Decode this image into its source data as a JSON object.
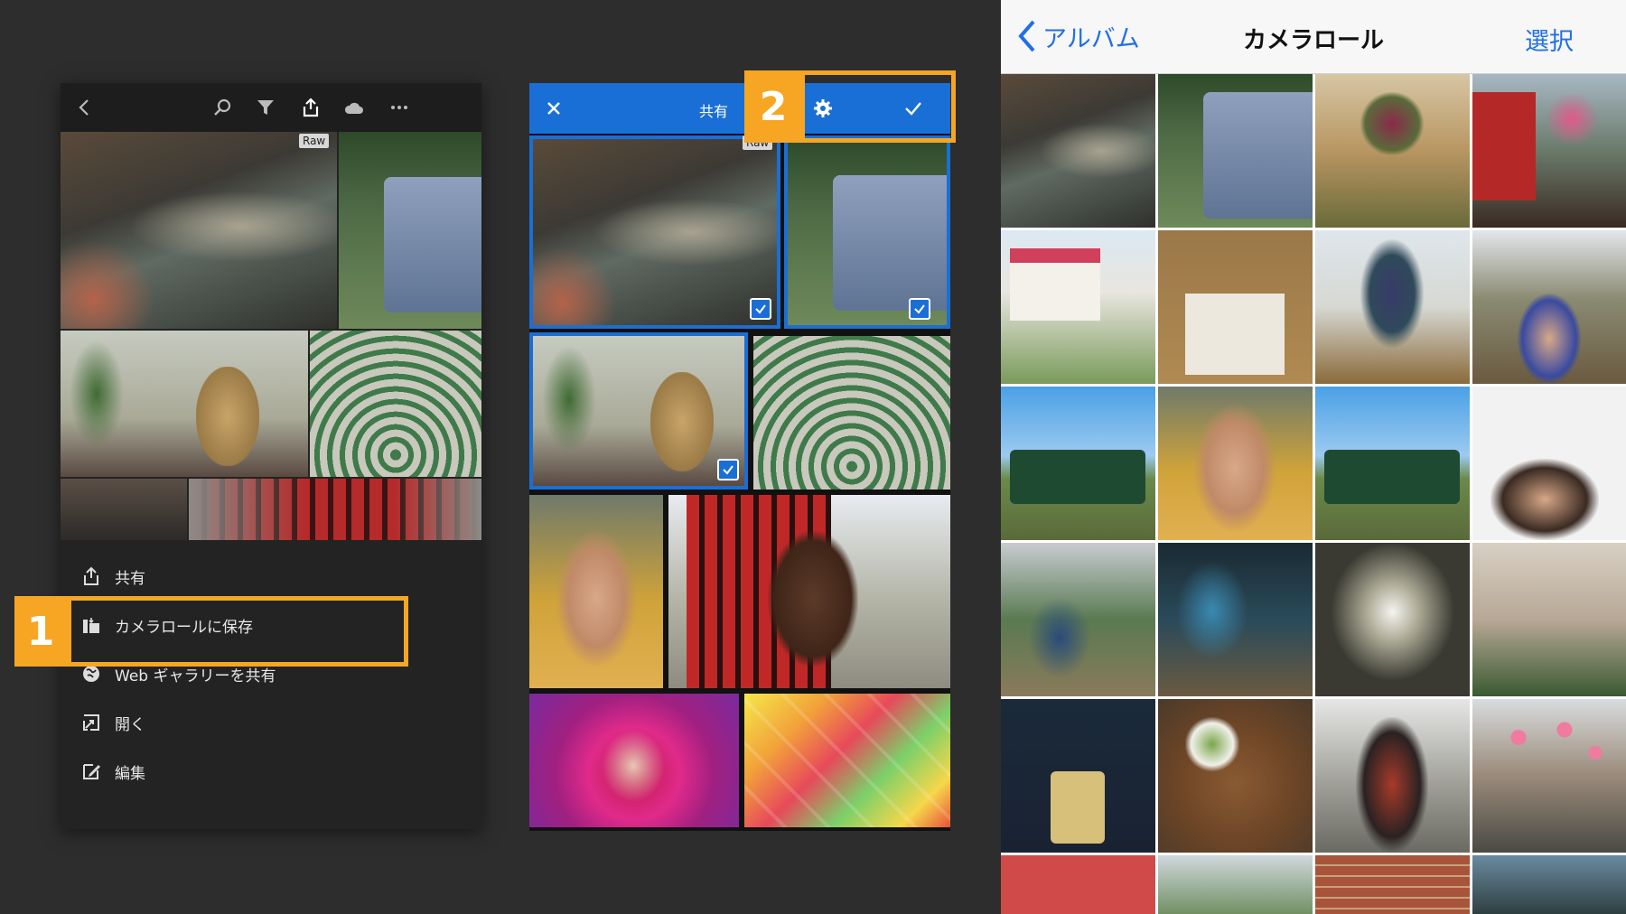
{
  "panel1": {
    "toolbar": {
      "icons": [
        "back-icon",
        "search-icon",
        "filter-icon",
        "share-icon",
        "cloud-icon",
        "more-icon"
      ]
    },
    "raw_badge": "Raw",
    "menu": [
      {
        "icon": "share-icon",
        "label": "共有"
      },
      {
        "icon": "camera-roll-save-icon",
        "label": "カメラロールに保存"
      },
      {
        "icon": "globe-icon",
        "label": "Web ギャラリーを共有"
      },
      {
        "icon": "open-icon",
        "label": "開く"
      },
      {
        "icon": "edit-icon",
        "label": "編集"
      }
    ]
  },
  "panel2": {
    "toolbar": {
      "close_icon": "close-icon",
      "title": "共有",
      "settings_icon": "gear-icon",
      "confirm_icon": "checkmark-icon"
    },
    "raw_badge": "Raw"
  },
  "callouts": {
    "one": "1",
    "two": "2",
    "color": "#f6a623"
  },
  "panel3": {
    "back_label": "アルバム",
    "title": "カメラロール",
    "select_label": "選択",
    "accent": "#1f6fe8"
  },
  "colors": {
    "selection_blue": "#1a6fd6",
    "background": "#2d2d2d"
  }
}
